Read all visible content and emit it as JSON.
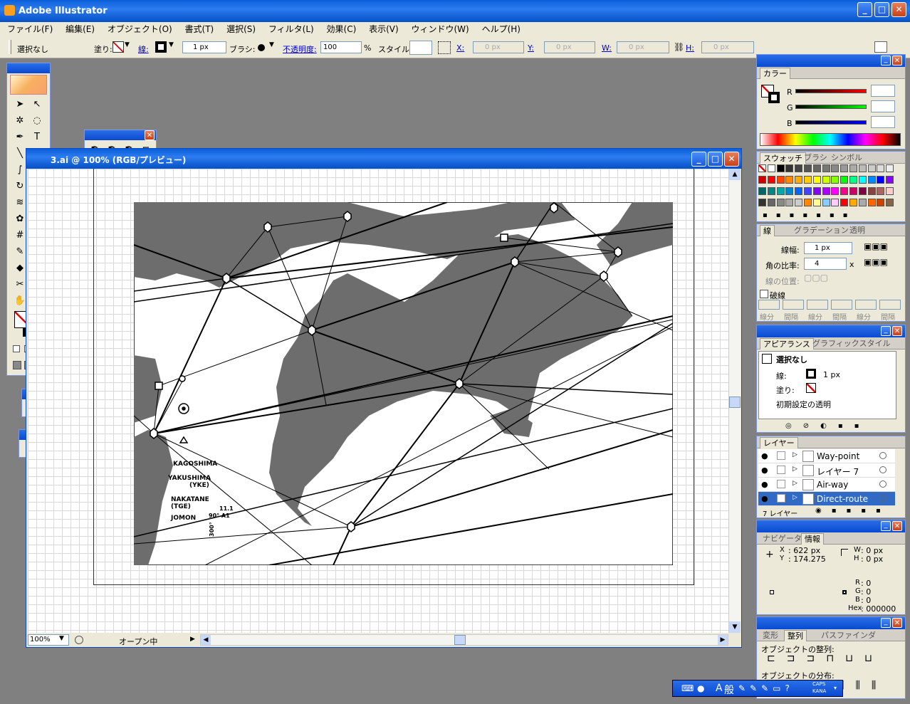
{
  "app": {
    "title": "Adobe Illustrator"
  },
  "menu": [
    "ファイル(F)",
    "編集(E)",
    "オブジェクト(O)",
    "書式(T)",
    "選択(S)",
    "フィルタ(L)",
    "効果(C)",
    "表示(V)",
    "ウィンドウ(W)",
    "ヘルプ(H)"
  ],
  "control": {
    "selection": "選択なし",
    "fill_label": "塗り:",
    "stroke_label": "線:",
    "stroke_width": "1 px",
    "brush_label": "ブラシ:",
    "opacity_label": "不透明度:",
    "opacity_value": "100",
    "percent": "%",
    "style_label": "スタイル:",
    "x_label": "X:",
    "x_value": "0 px",
    "y_label": "Y:",
    "y_value": "0 px",
    "w_label": "W:",
    "w_value": "0 px",
    "h_label": "H:",
    "h_value": "0 px"
  },
  "document": {
    "title": "3.ai @ 100% (RGB/プレビュー)",
    "zoom": "100%",
    "status": "オープン中"
  },
  "map": {
    "place_labels": [
      "KAGOSHIMA",
      "YAKUSHIMA",
      "(YKE)",
      "NAKATANE",
      "(TGE)",
      "JOMON",
      "11.1",
      "90° A1",
      "300°"
    ]
  },
  "color_panel": {
    "tab": "カラー",
    "r": "R",
    "g": "G",
    "b": "B"
  },
  "swatch_panel": {
    "tabs": [
      "スウォッチ",
      "ブラシ",
      "シンボル"
    ]
  },
  "stroke_panel": {
    "tabs": [
      "線",
      "グラデーション",
      "透明"
    ],
    "weight_label": "線幅:",
    "weight_value": "1 px",
    "miter_label": "角の比率:",
    "miter_value": "4",
    "miter_unit": "x",
    "align_label": "線の位置:",
    "dashed_label": "破線",
    "dash_labels": [
      "線分",
      "間隔",
      "線分",
      "間隔",
      "線分",
      "間隔"
    ]
  },
  "appearance_panel": {
    "tabs": [
      "アピアランス",
      "グラフィックスタイル"
    ],
    "selection": "選択なし",
    "stroke_label": "線:",
    "stroke_value": "1 px",
    "fill_label": "塗り:",
    "opacity_label": "初期設定の透明"
  },
  "layers_panel": {
    "tab": "レイヤー",
    "layers": [
      {
        "name": "Way-point",
        "selected": false
      },
      {
        "name": "レイヤー 7",
        "selected": false
      },
      {
        "name": "Air-way",
        "selected": false
      },
      {
        "name": "Direct-route",
        "selected": true
      }
    ],
    "footer": "7 レイヤー"
  },
  "info_panel": {
    "tabs": [
      "ナビゲータ",
      "情報"
    ],
    "x_label": "X",
    "x_value": ": 622 px",
    "y_label": "Y",
    "y_value": ": 174.275",
    "w_label": "W",
    "w_value": ": 0 px",
    "h_label": "H",
    "h_value": ": 0 px",
    "r_label": "R",
    "r_value": ": 0",
    "g_label": "G",
    "g_value": ": 0",
    "b_label": "B",
    "b_value": ": 0",
    "hex_label": "Hex",
    "hex_value": ": 000000"
  },
  "align_panel": {
    "tabs": [
      "変形",
      "整列",
      "パスファインダ"
    ],
    "align_label": "オブジェクトの整列:",
    "distribute_label": "オブジェクトの分布:"
  },
  "ime": {
    "mode": "A",
    "kana": "般",
    "caps": "CAPS",
    "kana_label": "KANA"
  },
  "colors": {
    "accent": "#0a4ad0",
    "land": "#6d6d6d",
    "close": "#d0502a"
  }
}
